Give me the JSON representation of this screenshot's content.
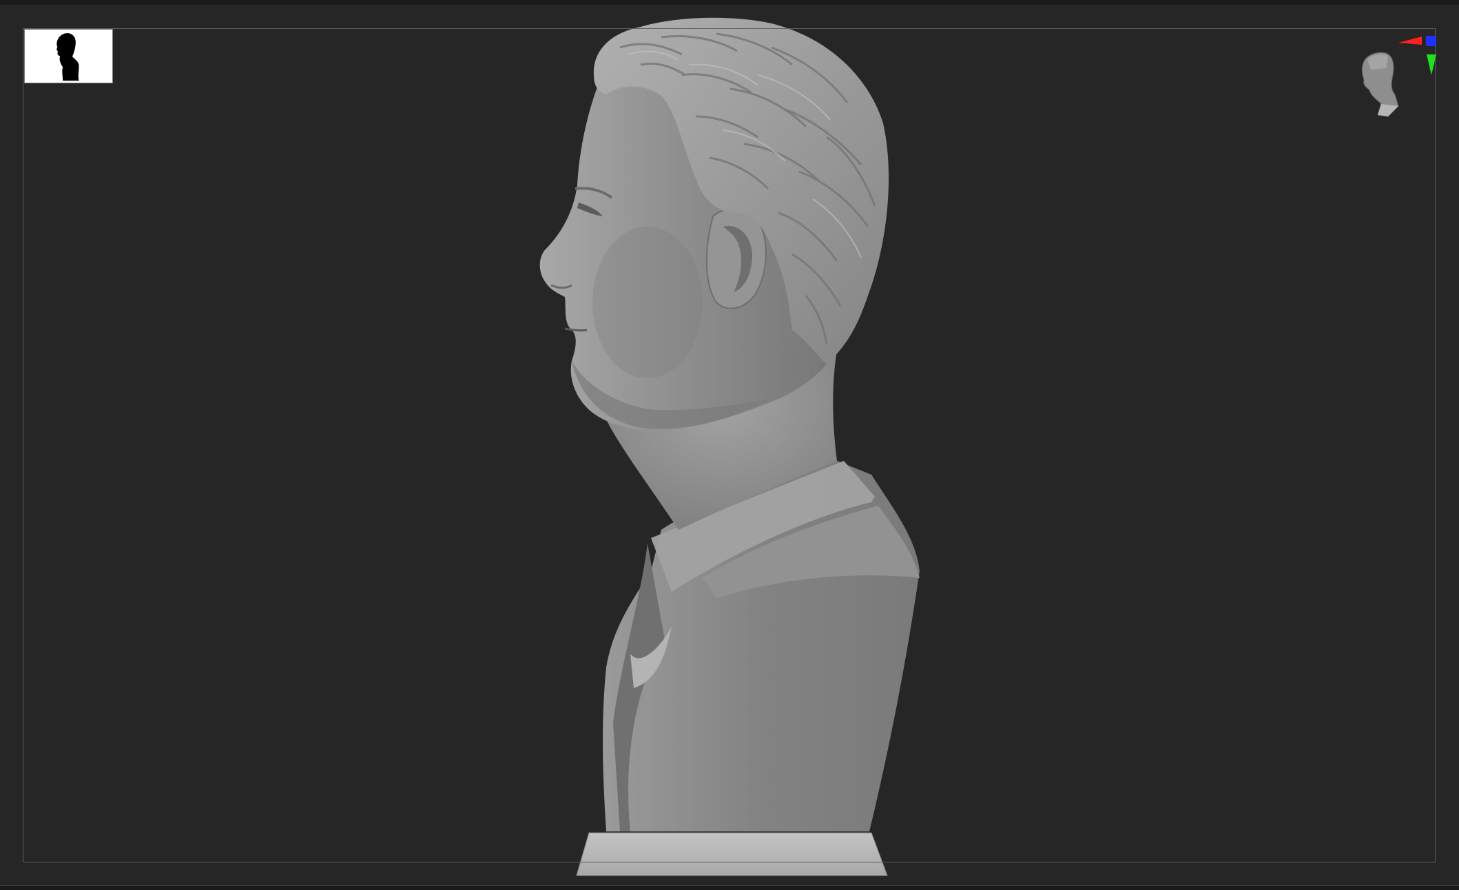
{
  "viewport": {
    "background_color": "#262626",
    "frame_color": "#5e5e5e",
    "model": "bust-side-profile",
    "model_color": "#8c8c8c"
  },
  "thumbnail": {
    "icon": "head-silhouette-icon",
    "background_color": "#ffffff",
    "silhouette_color": "#000000"
  },
  "gizmo": {
    "icon": "head-orientation-icon",
    "axes": [
      {
        "axis": "x",
        "color": "#ff2020"
      },
      {
        "axis": "y",
        "color": "#20e020"
      },
      {
        "axis": "z",
        "color": "#2030ff"
      }
    ]
  }
}
